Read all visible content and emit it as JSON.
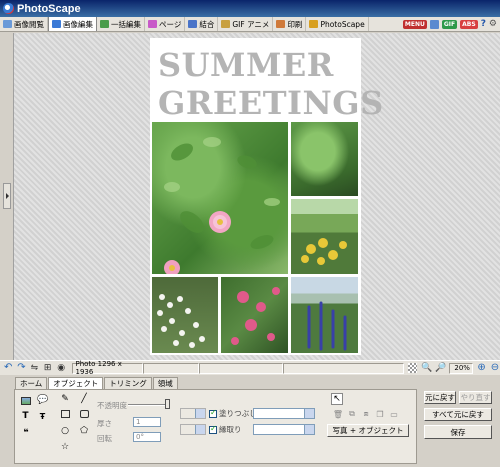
{
  "window": {
    "title": "PhotoScape"
  },
  "tabs": [
    {
      "label": "画像閲覧",
      "icon": "viewer-icon",
      "color": "#6a9ad8"
    },
    {
      "label": "画像編集",
      "icon": "editor-icon",
      "color": "#3b7ad6"
    },
    {
      "label": "一括編集",
      "icon": "batch-icon",
      "color": "#4a9c4a"
    },
    {
      "label": "ページ",
      "icon": "page-icon",
      "color": "#c85ac8"
    },
    {
      "label": "結合",
      "icon": "combine-icon",
      "color": "#4a74c8"
    },
    {
      "label": "GIF アニメ",
      "icon": "gif-icon",
      "color": "#c8a040"
    },
    {
      "label": "印刷",
      "icon": "print-icon",
      "color": "#d07a3a"
    },
    {
      "label": "PhotoScape",
      "icon": "photoscape-icon",
      "color": "#d8a020"
    }
  ],
  "toolbar_right": {
    "menu": "MENU",
    "gif": "GIF",
    "beta": "ABS"
  },
  "photo": {
    "line1": "SUMMER",
    "line2": "GREETINGS"
  },
  "status": {
    "info": "Photo 1296 x 1936",
    "zoom": "20%"
  },
  "subtabs": [
    "ホーム",
    "オブジェクト",
    "トリミング",
    "領域"
  ],
  "panel": {
    "opacity_label": "不透明度",
    "thickness_label": "厚さ",
    "thickness_value": "1",
    "rotate_label": "回転",
    "rotate_value": "0°",
    "fill_label": "塗りつぶし",
    "outline_label": "縁取り",
    "photo_object_button": "写真 + オブジェクト",
    "text_icon": "T",
    "quote_icon": "❝"
  },
  "actions": {
    "undo": "元に戻す",
    "redo": "やり直す",
    "undo_all": "すべて元に戻す",
    "save": "保存"
  }
}
